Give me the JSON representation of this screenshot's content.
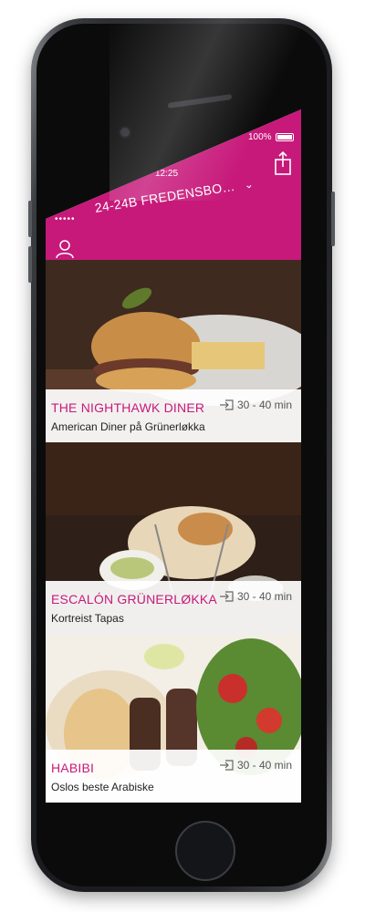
{
  "status": {
    "battery": "100%",
    "time": "12:25",
    "signal": "•••••"
  },
  "header": {
    "address": "24-24B FREDENSBO…",
    "chevron": "⌄",
    "icons": {
      "share": "share-icon",
      "user": "user-icon",
      "dropdown": "chevron-down-icon"
    }
  },
  "restaurants": [
    {
      "name": "THE NIGHTHAWK DINER",
      "description": "American Diner på Grünerløkka",
      "delivery": "30 - 40 min"
    },
    {
      "name": "ESCALÓN GRÜNERLØKKA",
      "description": "Kortreist Tapas",
      "delivery": "30 - 40 min"
    },
    {
      "name": "HABIBI",
      "description": "Oslos beste Arabiske",
      "delivery": "30 - 40 min"
    }
  ],
  "colors": {
    "accent": "#c7197a",
    "text": "#222222"
  }
}
